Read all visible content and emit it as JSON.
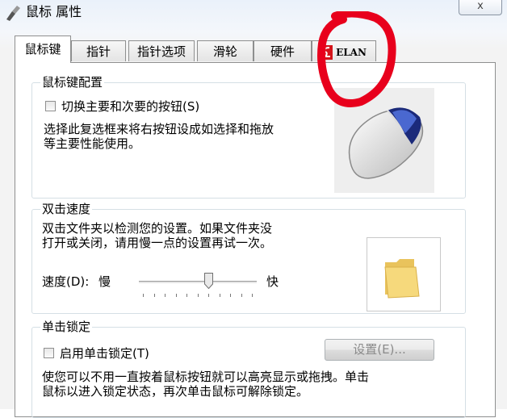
{
  "window": {
    "title": "鼠标 属性",
    "close_label": "x"
  },
  "tabs": [
    {
      "label": "鼠标键",
      "active": true
    },
    {
      "label": "指针",
      "active": false
    },
    {
      "label": "指针选项",
      "active": false
    },
    {
      "label": "滑轮",
      "active": false
    },
    {
      "label": "硬件",
      "active": false
    },
    {
      "label": "ELAN",
      "active": false
    }
  ],
  "button_config": {
    "title": "鼠标键配置",
    "checkbox_label": "切换主要和次要的按钮(S)",
    "checked": false,
    "description_line1": "选择此复选框来将右按钮设成如选择和拖放",
    "description_line2": "等主要性能使用。"
  },
  "double_click": {
    "title": "双击速度",
    "description_line1": "双击文件夹以检测您的设置。如果文件夹没",
    "description_line2": "打开或关闭，请用慢一点的设置再试一次。",
    "speed_label": "速度(D):",
    "slow_label": "慢",
    "fast_label": "快",
    "speed_value": 0.6,
    "tick_count": 11
  },
  "click_lock": {
    "title": "单击锁定",
    "checkbox_label": "启用单击锁定(T)",
    "checked": false,
    "settings_button": "设置(E)...",
    "description_line1": "使您可以不用一直按着鼠标按钮就可以高亮显示或拖拽。单击",
    "description_line2": "鼠标以进入锁定状态，再次单击鼠标可解除锁定。"
  },
  "annotation_color": "#e8001c"
}
